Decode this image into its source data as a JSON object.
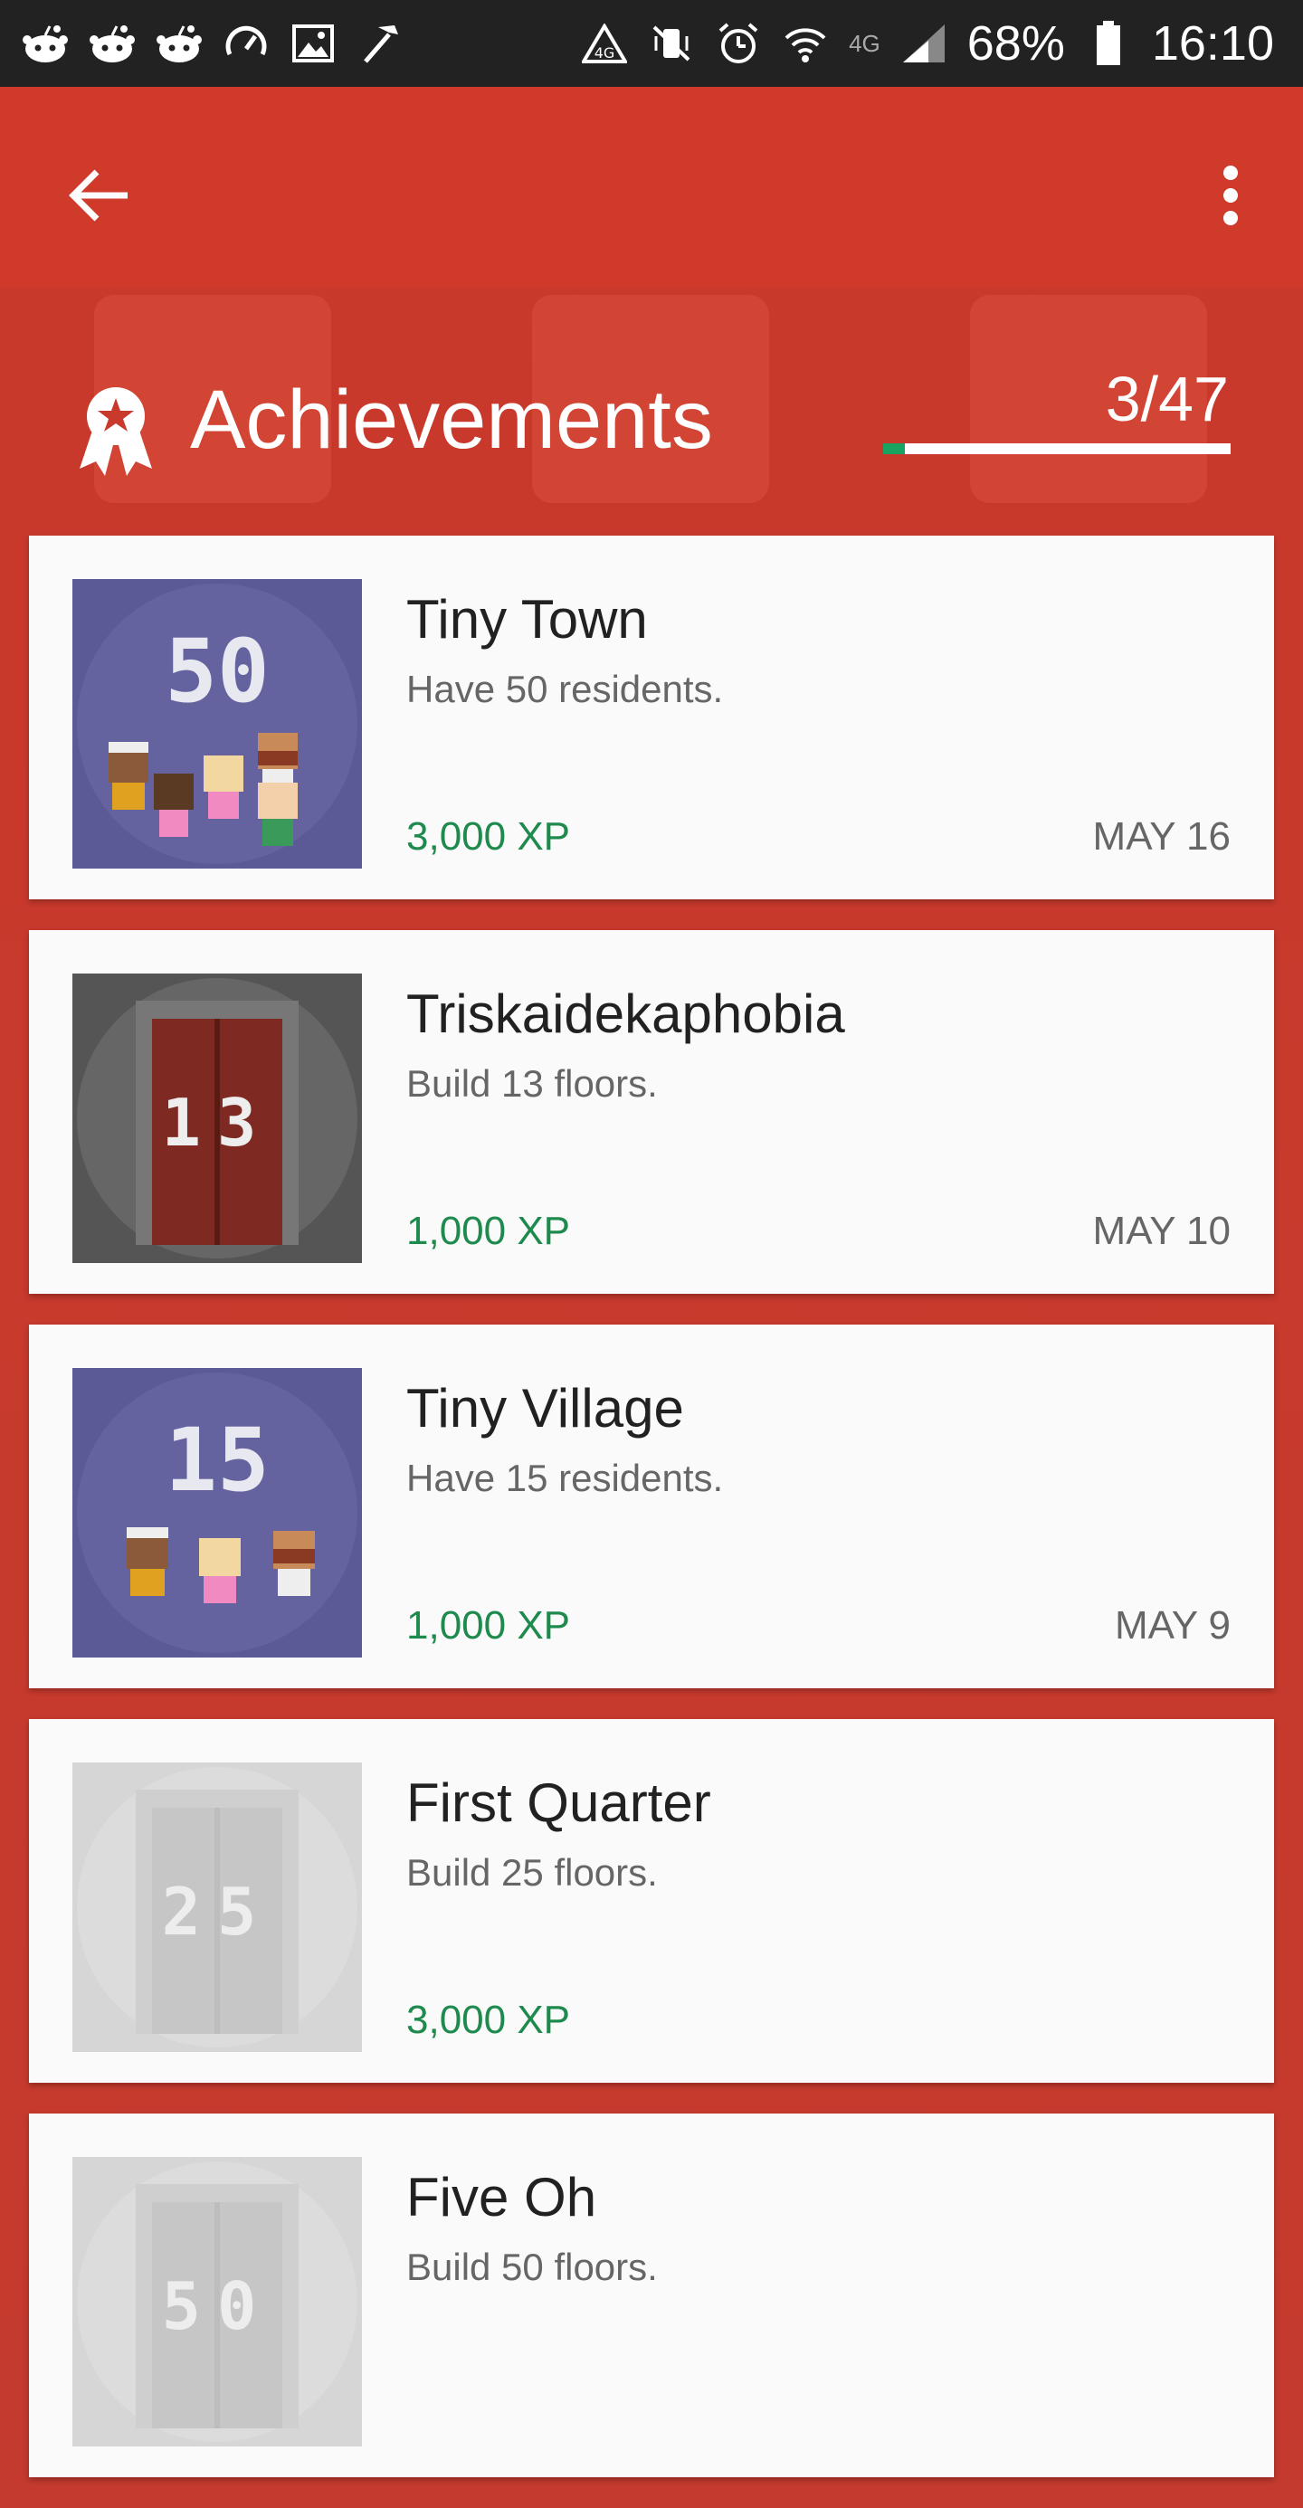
{
  "status_bar": {
    "battery_percent": "68%",
    "time": "16:10",
    "network_label": "4G",
    "left_icons": [
      "reddit-icon",
      "reddit-icon",
      "reddit-icon",
      "speedometer-icon",
      "image-icon",
      "hammer-icon"
    ],
    "right_icons": [
      "warning-icon",
      "mute-vibrate-icon",
      "alarm-icon",
      "wifi-icon",
      "signal-icon",
      "battery-icon"
    ]
  },
  "app_bar": {
    "back_icon": "arrow-left-icon",
    "menu_icon": "more-vertical-icon"
  },
  "header": {
    "title": "Achievements",
    "count": "3/47",
    "progress_fraction": 0.0638,
    "icon": "award-ribbon-icon"
  },
  "achievements": [
    {
      "title": "Tiny Town",
      "description": "Have 50 residents.",
      "xp": "3,000 XP",
      "date": "MAY 16",
      "badge": "50",
      "unlocked": true,
      "art": "residents"
    },
    {
      "title": "Triskaidekaphobia",
      "description": "Build 13 floors.",
      "xp": "1,000 XP",
      "date": "MAY 10",
      "badge": "13",
      "unlocked": true,
      "art": "elevator"
    },
    {
      "title": "Tiny Village",
      "description": "Have 15 residents.",
      "xp": "1,000 XP",
      "date": "MAY 9",
      "badge": "15",
      "unlocked": true,
      "art": "residents"
    },
    {
      "title": "First Quarter",
      "description": "Build 25 floors.",
      "xp": "3,000 XP",
      "date": "",
      "badge": "25",
      "unlocked": false,
      "art": "elevator"
    },
    {
      "title": "Five Oh",
      "description": "Build 50 floors.",
      "xp": "",
      "date": "",
      "badge": "50",
      "unlocked": false,
      "art": "elevator"
    }
  ],
  "colors": {
    "app_bar": "#cf3a2b",
    "background": "#c53a2d",
    "xp_green": "#1e8a4e",
    "progress_green": "#1aa260",
    "badge_purple": "#5b5a96"
  }
}
